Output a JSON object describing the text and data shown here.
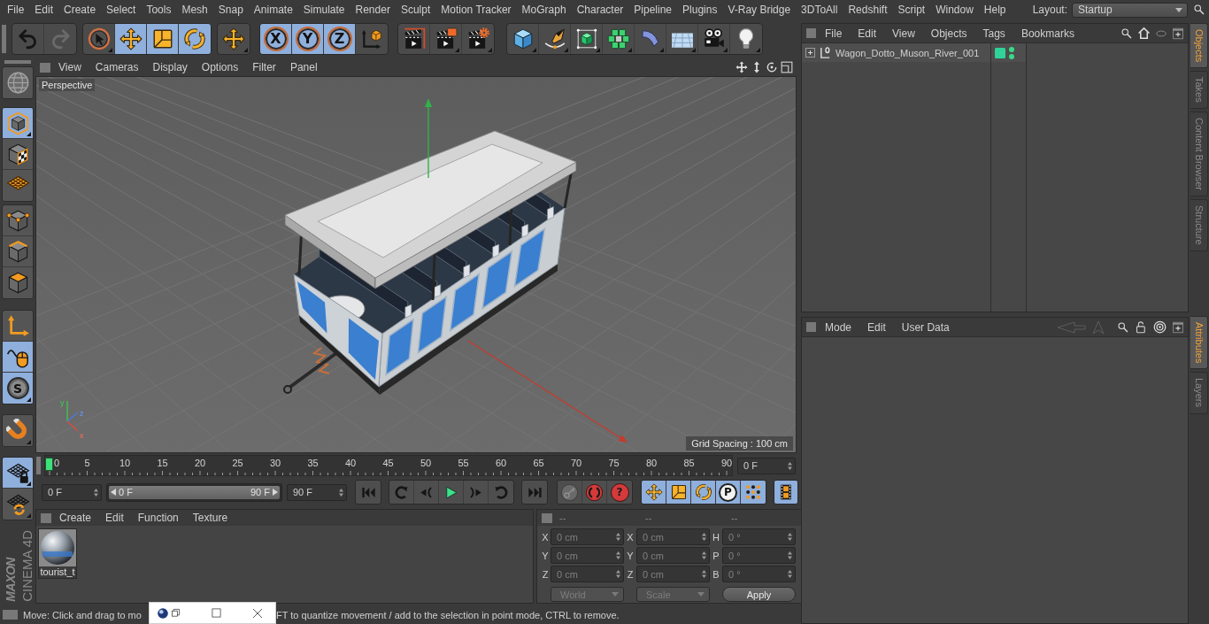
{
  "menu_bar": {
    "items": [
      "File",
      "Edit",
      "Create",
      "Select",
      "Tools",
      "Mesh",
      "Snap",
      "Animate",
      "Simulate",
      "Render",
      "Sculpt",
      "Motion Tracker",
      "MoGraph",
      "Character",
      "Pipeline",
      "Plugins",
      "V-Ray Bridge",
      "3DToAll",
      "Redshift",
      "Script",
      "Window",
      "Help"
    ],
    "layout_label": "Layout:",
    "layout_value": "Startup"
  },
  "toolbar": {
    "groups": [
      {
        "tools": [
          {
            "kind": "undo",
            "disabled": false
          },
          {
            "kind": "redo",
            "disabled": true
          }
        ]
      },
      {
        "tools": [
          {
            "kind": "live-selection",
            "selected": false
          },
          {
            "kind": "move",
            "selected": true
          },
          {
            "kind": "scale",
            "selected": true
          },
          {
            "kind": "rotate",
            "selected": true
          }
        ]
      },
      {
        "tools": [
          {
            "kind": "recent-move",
            "selected": false
          }
        ]
      },
      {
        "tools": [
          {
            "kind": "axis",
            "label": "X",
            "selected": true
          },
          {
            "kind": "axis",
            "label": "Y",
            "selected": true
          },
          {
            "kind": "axis",
            "label": "Z",
            "selected": true
          },
          {
            "kind": "coordinate-system",
            "selected": false
          }
        ]
      },
      {
        "tools": [
          {
            "kind": "render-view"
          },
          {
            "kind": "render-picture"
          },
          {
            "kind": "render-settings"
          }
        ]
      },
      {
        "tools": [
          {
            "kind": "cube"
          },
          {
            "kind": "pen"
          },
          {
            "kind": "subdivision"
          },
          {
            "kind": "cloner"
          },
          {
            "kind": "bend"
          },
          {
            "kind": "floor"
          },
          {
            "kind": "camera"
          },
          {
            "kind": "light"
          }
        ]
      }
    ]
  },
  "left_toolbar": {
    "groups": [
      {
        "tools": [
          {
            "kind": "convert"
          }
        ]
      },
      {
        "tools": [
          {
            "kind": "model",
            "selected": true
          },
          {
            "kind": "texture",
            "selected": false
          },
          {
            "kind": "workplane",
            "selected": false
          }
        ]
      },
      {
        "tools": [
          {
            "kind": "points",
            "selected": false
          },
          {
            "kind": "edges",
            "selected": false
          },
          {
            "kind": "polygons",
            "selected": false
          }
        ]
      },
      {
        "tools": [
          {
            "kind": "axis-mode",
            "selected": false
          },
          {
            "kind": "tweak",
            "selected": true
          },
          {
            "kind": "solo",
            "label": "S",
            "selected": true
          }
        ]
      },
      {
        "tools": [
          {
            "kind": "snap",
            "selected": false
          }
        ]
      },
      {
        "tools": [
          {
            "kind": "locked-workplane",
            "selected": true
          },
          {
            "kind": "planar-workplane",
            "selected": false
          }
        ]
      }
    ]
  },
  "logo": {
    "brand": "MAXON",
    "product": "CINEMA 4D"
  },
  "viewport": {
    "menu": [
      "View",
      "Cameras",
      "Display",
      "Options",
      "Filter",
      "Panel"
    ],
    "camera": "Perspective",
    "grid_spacing": "Grid Spacing : 100 cm",
    "gizmo_axes": [
      "y",
      "z",
      "x"
    ]
  },
  "timeline": {
    "frames": [
      "0",
      "5",
      "10",
      "15",
      "20",
      "25",
      "30",
      "35",
      "40",
      "45",
      "50",
      "55",
      "60",
      "65",
      "70",
      "75",
      "80",
      "85",
      "90"
    ],
    "level": 0,
    "current_frame": "0 F"
  },
  "playback": {
    "start": "0 F",
    "range": {
      "start": "0 F",
      "end": "90 F",
      "level": 1
    },
    "end": "90 F",
    "transport": [
      {
        "buttons": [
          {
            "kind": "first"
          }
        ]
      },
      {
        "buttons": [
          {
            "kind": "prev-key"
          },
          {
            "kind": "prev-frame"
          },
          {
            "kind": "play"
          },
          {
            "kind": "next-frame"
          },
          {
            "kind": "next-key"
          }
        ]
      },
      {
        "buttons": [
          {
            "kind": "last"
          }
        ]
      }
    ],
    "record": [
      {
        "kind": "keyframe",
        "disabled": true
      },
      {
        "kind": "autokey",
        "disabled": false
      },
      {
        "kind": "key-selection",
        "label": "?",
        "disabled": false
      }
    ],
    "key_tracks": [
      {
        "kind": "position",
        "selected": true
      },
      {
        "kind": "scale",
        "selected": true
      },
      {
        "kind": "rotation",
        "selected": true
      },
      {
        "kind": "parameter",
        "label": "P",
        "selected": true
      },
      {
        "kind": "points",
        "selected": true
      }
    ],
    "timeline_button": {
      "selected": true
    }
  },
  "materials": {
    "menu": [
      "Create",
      "Edit",
      "Function",
      "Texture"
    ],
    "items": [
      {
        "name": "tourist_t"
      }
    ]
  },
  "coordinates": {
    "disabled": true,
    "headers": [
      "--",
      "--",
      "--"
    ],
    "rows": [
      {
        "position_axis": "X",
        "position": "0 cm",
        "size_axis": "X",
        "size": "0 cm",
        "rotation_axis": "H",
        "rotation": "0 °"
      },
      {
        "position_axis": "Y",
        "position": "0 cm",
        "size_axis": "Y",
        "size": "0 cm",
        "rotation_axis": "P",
        "rotation": "0 °"
      },
      {
        "position_axis": "Z",
        "position": "0 cm",
        "size_axis": "Z",
        "size": "0 cm",
        "rotation_axis": "B",
        "rotation": "0 °"
      }
    ],
    "dropdowns": [
      "World",
      "Scale"
    ],
    "apply": "Apply"
  },
  "status_bar": {
    "text_start": "Move: Click and drag to mo",
    "text_end": "FT to quantize movement / add to the selection in point mode, CTRL to remove."
  },
  "object_manager": {
    "menu": [
      "File",
      "Edit",
      "View",
      "Objects",
      "Tags",
      "Bookmarks"
    ],
    "objects": [
      {
        "name": "Wagon_Dotto_Muson_River_001",
        "expanded": false,
        "color": "#2fd39a",
        "editor_visible": true,
        "render_visible": true
      }
    ]
  },
  "side_tabs_top": [
    {
      "label": "Objects",
      "selected": true
    },
    {
      "label": "Takes",
      "selected": false
    },
    {
      "label": "Content Browser",
      "selected": false
    },
    {
      "label": "Structure",
      "selected": false
    }
  ],
  "attribute_manager": {
    "menu": [
      "Mode",
      "Edit",
      "User Data"
    ]
  },
  "side_tabs_bottom": [
    {
      "label": "Attributes",
      "selected": true
    },
    {
      "label": "Layers",
      "selected": false
    }
  ]
}
